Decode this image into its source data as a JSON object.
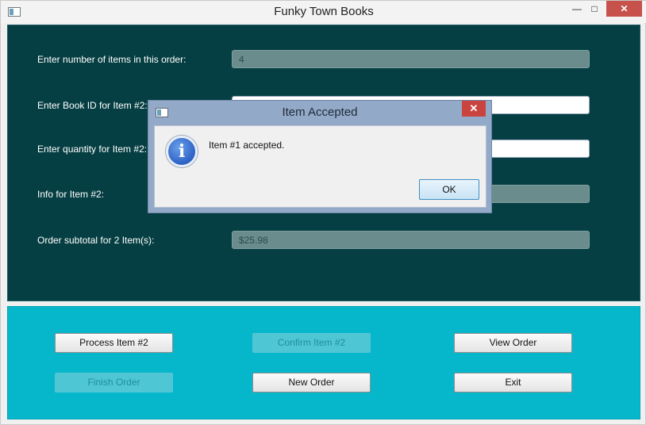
{
  "window": {
    "title": "Funky Town Books",
    "controls": {
      "minimize": "—",
      "maximize": "□",
      "close": "✕"
    }
  },
  "form": {
    "rows": [
      {
        "label": "Enter number of items in this order:",
        "value": "4",
        "readonly": true
      },
      {
        "label": "Enter Book ID for Item #2:",
        "value": "",
        "readonly": false
      },
      {
        "label": "Enter quantity for Item #2:",
        "value": "",
        "readonly": false
      },
      {
        "label": "Info for Item #2:",
        "value": "",
        "readonly": true
      },
      {
        "label": "Order subtotal for 2 Item(s):",
        "value": "$25.98",
        "readonly": true
      }
    ]
  },
  "buttons": {
    "process": "Process Item #2",
    "confirm": "Confirm Item #2",
    "view": "View Order",
    "finish": "Finish Order",
    "new": "New Order",
    "exit": "Exit"
  },
  "dialog": {
    "title": "Item Accepted",
    "message": "Item #1 accepted.",
    "ok_label": "OK",
    "close": "✕",
    "info_glyph": "i"
  },
  "icons": {
    "app": "app-window-icon",
    "info": "info-icon"
  },
  "colors": {
    "top_panel": "#063f43",
    "bottom_panel": "#06b7cc",
    "readonly_field": "#6b8c8c",
    "disabled_button": "#4fc6d4"
  }
}
